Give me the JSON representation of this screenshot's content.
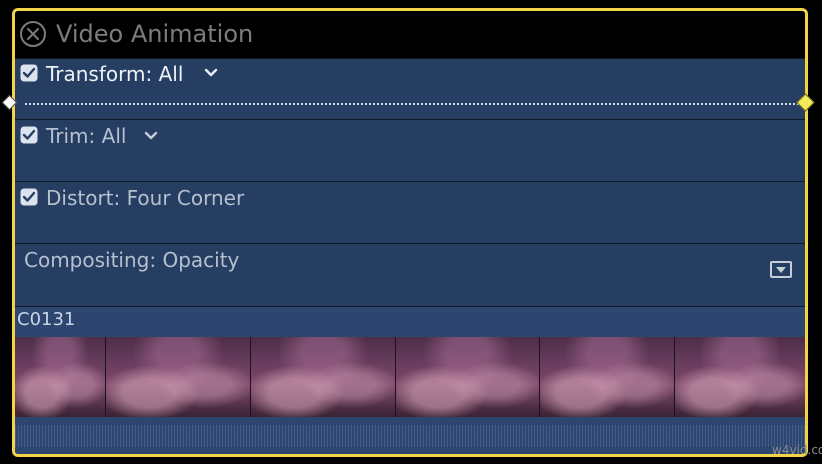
{
  "inspector": {
    "title": "Video Animation",
    "rows": [
      {
        "label": "Transform: All",
        "checked": true,
        "has_chevron": true
      },
      {
        "label": "Trim: All",
        "checked": true,
        "has_chevron": true
      },
      {
        "label": "Distort: Four Corner",
        "checked": true,
        "has_chevron": false
      },
      {
        "label": "Compositing: Opacity",
        "checked": false,
        "has_menu": true
      }
    ]
  },
  "clip": {
    "name": "C0131"
  },
  "watermark": "w4vid.com",
  "icons": {
    "close": "close-circle-icon",
    "checkbox": "checkbox-checked-icon",
    "chevron": "chevron-down-icon",
    "menu": "popup-menu-icon",
    "keyframe": "keyframe-diamond-icon"
  },
  "colors": {
    "selection_border": "#f2d34a",
    "keyframe_active": "#f4ea5a",
    "keyframe_inactive": "#ffffff",
    "row_bg": "#253e62"
  }
}
